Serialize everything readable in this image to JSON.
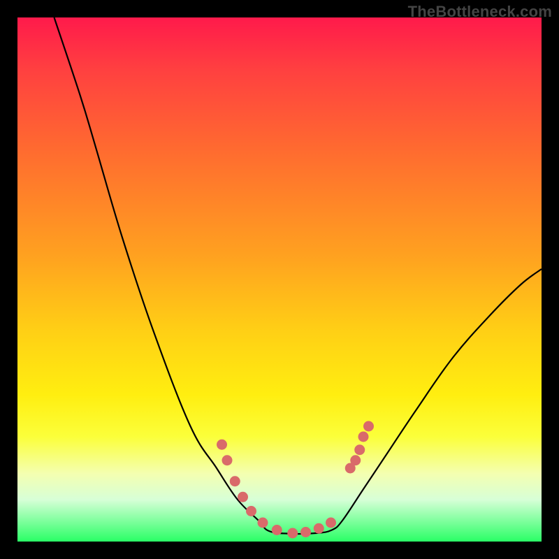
{
  "watermark": "TheBottleneck.com",
  "chart_data": {
    "type": "line",
    "title": "",
    "xlabel": "",
    "ylabel": "",
    "xlim": [
      0,
      100
    ],
    "ylim": [
      0,
      100
    ],
    "grid": false,
    "curve": {
      "left_branch": [
        {
          "x": 7,
          "y": 100
        },
        {
          "x": 12,
          "y": 85
        },
        {
          "x": 15,
          "y": 75
        },
        {
          "x": 20,
          "y": 58
        },
        {
          "x": 26,
          "y": 40
        },
        {
          "x": 33,
          "y": 22
        },
        {
          "x": 38,
          "y": 14
        },
        {
          "x": 42,
          "y": 8
        },
        {
          "x": 46,
          "y": 4
        }
      ],
      "bottom": [
        {
          "x": 48,
          "y": 2.0
        },
        {
          "x": 52,
          "y": 1.5
        },
        {
          "x": 57,
          "y": 1.6
        },
        {
          "x": 60,
          "y": 2.2
        }
      ],
      "right_branch": [
        {
          "x": 62,
          "y": 4
        },
        {
          "x": 66,
          "y": 10
        },
        {
          "x": 70,
          "y": 16
        },
        {
          "x": 76,
          "y": 25
        },
        {
          "x": 83,
          "y": 35
        },
        {
          "x": 90,
          "y": 43
        },
        {
          "x": 96,
          "y": 49
        },
        {
          "x": 100,
          "y": 52
        }
      ]
    },
    "dots": [
      {
        "x": 39.0,
        "y": 18.5
      },
      {
        "x": 40.0,
        "y": 15.5
      },
      {
        "x": 41.5,
        "y": 11.5
      },
      {
        "x": 43.0,
        "y": 8.5
      },
      {
        "x": 44.6,
        "y": 5.8
      },
      {
        "x": 46.8,
        "y": 3.6
      },
      {
        "x": 49.5,
        "y": 2.2
      },
      {
        "x": 52.5,
        "y": 1.6
      },
      {
        "x": 55.0,
        "y": 1.8
      },
      {
        "x": 57.5,
        "y": 2.5
      },
      {
        "x": 59.8,
        "y": 3.6
      },
      {
        "x": 63.5,
        "y": 14.0
      },
      {
        "x": 64.5,
        "y": 15.5
      },
      {
        "x": 65.3,
        "y": 17.5
      },
      {
        "x": 66.0,
        "y": 20.0
      },
      {
        "x": 67.0,
        "y": 22.0
      }
    ],
    "colors": {
      "line": "#000000",
      "dots": "#d96a6a",
      "gradient_top": "#ff1a4b",
      "gradient_mid": "#ffd015",
      "gradient_bottom": "#2aff66"
    }
  }
}
